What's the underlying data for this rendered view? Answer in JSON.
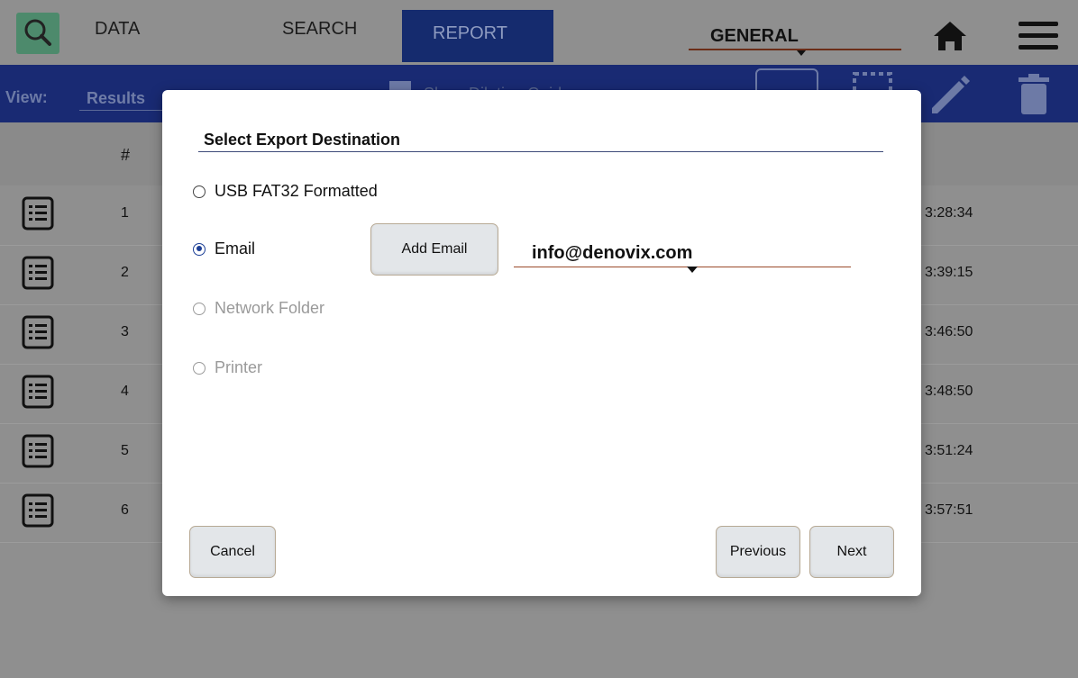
{
  "nav": {
    "tabs": [
      "DATA",
      "SEARCH",
      "REPORT"
    ],
    "active_tab": "REPORT",
    "general_label": "GENERAL"
  },
  "subbar": {
    "view_label": "View:",
    "view_value": "Results",
    "dilution_label": "Show Dilution Guide"
  },
  "table": {
    "header_hash": "#",
    "rows": [
      {
        "num": "1",
        "time": "3:28:34"
      },
      {
        "num": "2",
        "time": "3:39:15"
      },
      {
        "num": "3",
        "time": "3:46:50"
      },
      {
        "num": "4",
        "time": "3:48:50"
      },
      {
        "num": "5",
        "time": "3:51:24"
      },
      {
        "num": "6",
        "time": "3:57:51"
      }
    ]
  },
  "modal": {
    "title": "Select Export Destination",
    "options": [
      {
        "label": "USB FAT32 Formatted",
        "checked": false,
        "enabled": true
      },
      {
        "label": "Email",
        "checked": true,
        "enabled": true
      },
      {
        "label": "Network Folder",
        "checked": false,
        "enabled": false
      },
      {
        "label": "Printer",
        "checked": false,
        "enabled": false
      }
    ],
    "add_email_label": "Add Email",
    "email_value": "info@denovix.com",
    "cancel_label": "Cancel",
    "previous_label": "Previous",
    "next_label": "Next"
  },
  "colors": {
    "active_tab": "#152b6e",
    "subbar": "#192a73",
    "radio_selected": "#1c3f96",
    "underline_accent": "#9a4a2a"
  }
}
